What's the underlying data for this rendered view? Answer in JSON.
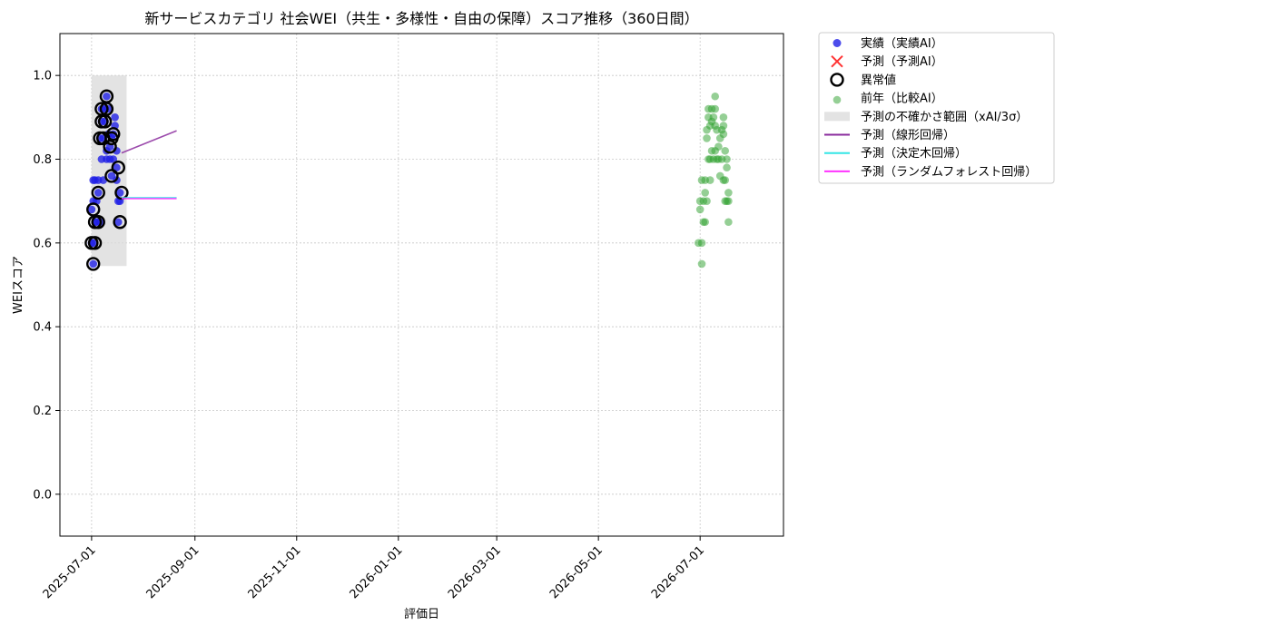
{
  "chart_data": {
    "type": "scatter",
    "title": "新サービスカテゴリ 社会WEI（共生・多様性・自由の保障）スコア推移（360日間）",
    "xlabel": "評価日",
    "ylabel": "WEIスコア",
    "xlim": [
      "2025-06-12",
      "2026-08-20"
    ],
    "ylim": [
      -0.1,
      1.1
    ],
    "x_ticks": [
      "2025-07-01",
      "2025-09-01",
      "2025-11-01",
      "2026-01-01",
      "2026-03-01",
      "2026-05-01",
      "2026-07-01"
    ],
    "y_ticks": [
      0.0,
      0.2,
      0.4,
      0.6,
      0.8,
      1.0
    ],
    "y_tick_labels": [
      "0.0",
      "0.2",
      "0.4",
      "0.6",
      "0.8",
      "1.0"
    ],
    "grid": true,
    "legend_position": "outside-top-right",
    "colors": {
      "actual": "#1f1fe6",
      "predicted": "#ff3333",
      "anomaly": "#000000",
      "previous": "#2ca02c",
      "band": "#d9d9d9",
      "linear": "#8b2c9e",
      "tree": "#33e6e6",
      "forest": "#ff33ff"
    },
    "legend": [
      {
        "label": "実績（実績AI）",
        "kind": "actual"
      },
      {
        "label": "予測（予測AI）",
        "kind": "predicted"
      },
      {
        "label": "異常値",
        "kind": "anomaly"
      },
      {
        "label": "前年（比較AI）",
        "kind": "previous"
      },
      {
        "label": "予測の不確かさ範囲（xAI/3σ）",
        "kind": "band"
      },
      {
        "label": "予測（線形回帰）",
        "kind": "linear"
      },
      {
        "label": "予測（決定木回帰）",
        "kind": "tree"
      },
      {
        "label": "予測（ランダムフォレスト回帰）",
        "kind": "forest"
      }
    ],
    "series": [
      {
        "name": "実績（実績AI）",
        "points": [
          [
            "2025-07-01",
            0.6
          ],
          [
            "2025-07-01",
            0.68
          ],
          [
            "2025-07-02",
            0.55
          ],
          [
            "2025-07-02",
            0.6
          ],
          [
            "2025-07-02",
            0.7
          ],
          [
            "2025-07-02",
            0.75
          ],
          [
            "2025-07-03",
            0.65
          ],
          [
            "2025-07-03",
            0.75
          ],
          [
            "2025-07-04",
            0.7
          ],
          [
            "2025-07-04",
            0.65
          ],
          [
            "2025-07-05",
            0.72
          ],
          [
            "2025-07-05",
            0.75
          ],
          [
            "2025-07-06",
            0.65
          ],
          [
            "2025-07-06",
            0.85
          ],
          [
            "2025-07-07",
            0.92
          ],
          [
            "2025-07-07",
            0.89
          ],
          [
            "2025-07-07",
            0.8
          ],
          [
            "2025-07-08",
            0.85
          ],
          [
            "2025-07-08",
            0.75
          ],
          [
            "2025-07-09",
            0.89
          ],
          [
            "2025-07-09",
            0.92
          ],
          [
            "2025-07-10",
            0.95
          ],
          [
            "2025-07-10",
            0.82
          ],
          [
            "2025-07-10",
            0.8
          ],
          [
            "2025-07-11",
            0.92
          ],
          [
            "2025-07-11",
            0.86
          ],
          [
            "2025-07-12",
            0.83
          ],
          [
            "2025-07-12",
            0.8
          ],
          [
            "2025-07-13",
            0.85
          ],
          [
            "2025-07-13",
            0.76
          ],
          [
            "2025-07-14",
            0.86
          ],
          [
            "2025-07-14",
            0.8
          ],
          [
            "2025-07-15",
            0.9
          ],
          [
            "2025-07-15",
            0.88
          ],
          [
            "2025-07-16",
            0.78
          ],
          [
            "2025-07-16",
            0.82
          ],
          [
            "2025-07-16",
            0.75
          ],
          [
            "2025-07-17",
            0.7
          ],
          [
            "2025-07-17",
            0.65
          ],
          [
            "2025-07-18",
            0.72
          ],
          [
            "2025-07-18",
            0.7
          ]
        ]
      },
      {
        "name": "異常値",
        "points": [
          [
            "2025-07-01",
            0.6
          ],
          [
            "2025-07-02",
            0.68
          ],
          [
            "2025-07-02",
            0.55
          ],
          [
            "2025-07-03",
            0.6
          ],
          [
            "2025-07-03",
            0.65
          ],
          [
            "2025-07-05",
            0.65
          ],
          [
            "2025-07-05",
            0.72
          ],
          [
            "2025-07-06",
            0.85
          ],
          [
            "2025-07-07",
            0.89
          ],
          [
            "2025-07-07",
            0.92
          ],
          [
            "2025-07-08",
            0.85
          ],
          [
            "2025-07-09",
            0.89
          ],
          [
            "2025-07-10",
            0.95
          ],
          [
            "2025-07-10",
            0.92
          ],
          [
            "2025-07-12",
            0.83
          ],
          [
            "2025-07-13",
            0.85
          ],
          [
            "2025-07-13",
            0.76
          ],
          [
            "2025-07-14",
            0.86
          ],
          [
            "2025-07-17",
            0.78
          ],
          [
            "2025-07-18",
            0.65
          ],
          [
            "2025-07-19",
            0.72
          ]
        ]
      },
      {
        "name": "前年（比較AI）",
        "points": [
          [
            "2026-06-30",
            0.6
          ],
          [
            "2026-07-01",
            0.7
          ],
          [
            "2026-07-01",
            0.68
          ],
          [
            "2026-07-02",
            0.55
          ],
          [
            "2026-07-02",
            0.6
          ],
          [
            "2026-07-02",
            0.75
          ],
          [
            "2026-07-03",
            0.65
          ],
          [
            "2026-07-03",
            0.7
          ],
          [
            "2026-07-04",
            0.72
          ],
          [
            "2026-07-04",
            0.75
          ],
          [
            "2026-07-04",
            0.65
          ],
          [
            "2026-07-05",
            0.85
          ],
          [
            "2026-07-05",
            0.87
          ],
          [
            "2026-07-05",
            0.7
          ],
          [
            "2026-07-06",
            0.8
          ],
          [
            "2026-07-06",
            0.9
          ],
          [
            "2026-07-06",
            0.92
          ],
          [
            "2026-07-07",
            0.88
          ],
          [
            "2026-07-07",
            0.75
          ],
          [
            "2026-07-07",
            0.8
          ],
          [
            "2026-07-08",
            0.82
          ],
          [
            "2026-07-08",
            0.89
          ],
          [
            "2026-07-08",
            0.92
          ],
          [
            "2026-07-09",
            0.9
          ],
          [
            "2026-07-09",
            0.8
          ],
          [
            "2026-07-10",
            0.95
          ],
          [
            "2026-07-10",
            0.92
          ],
          [
            "2026-07-10",
            0.88
          ],
          [
            "2026-07-10",
            0.82
          ],
          [
            "2026-07-11",
            0.87
          ],
          [
            "2026-07-11",
            0.8
          ],
          [
            "2026-07-12",
            0.83
          ],
          [
            "2026-07-12",
            0.8
          ],
          [
            "2026-07-13",
            0.85
          ],
          [
            "2026-07-13",
            0.76
          ],
          [
            "2026-07-14",
            0.87
          ],
          [
            "2026-07-14",
            0.8
          ],
          [
            "2026-07-15",
            0.9
          ],
          [
            "2026-07-15",
            0.88
          ],
          [
            "2026-07-15",
            0.86
          ],
          [
            "2026-07-15",
            0.75
          ],
          [
            "2026-07-16",
            0.82
          ],
          [
            "2026-07-16",
            0.7
          ],
          [
            "2026-07-16",
            0.75
          ],
          [
            "2026-07-17",
            0.8
          ],
          [
            "2026-07-17",
            0.78
          ],
          [
            "2026-07-17",
            0.7
          ],
          [
            "2026-07-18",
            0.65
          ],
          [
            "2026-07-18",
            0.72
          ],
          [
            "2026-07-18",
            0.7
          ]
        ]
      },
      {
        "name": "予測（線形回帰）",
        "points": [
          [
            "2025-07-19",
            0.815
          ],
          [
            "2025-08-21",
            0.868
          ]
        ]
      },
      {
        "name": "予測（決定木回帰）",
        "points": [
          [
            "2025-07-19",
            0.708
          ],
          [
            "2025-08-21",
            0.708
          ]
        ]
      },
      {
        "name": "予測（ランダムフォレスト回帰）",
        "points": [
          [
            "2025-07-19",
            0.706
          ],
          [
            "2025-08-21",
            0.706
          ]
        ]
      }
    ],
    "uncertainty_band": {
      "x": [
        "2025-07-01",
        "2025-07-22"
      ],
      "y": [
        0.545,
        1.0
      ]
    }
  }
}
